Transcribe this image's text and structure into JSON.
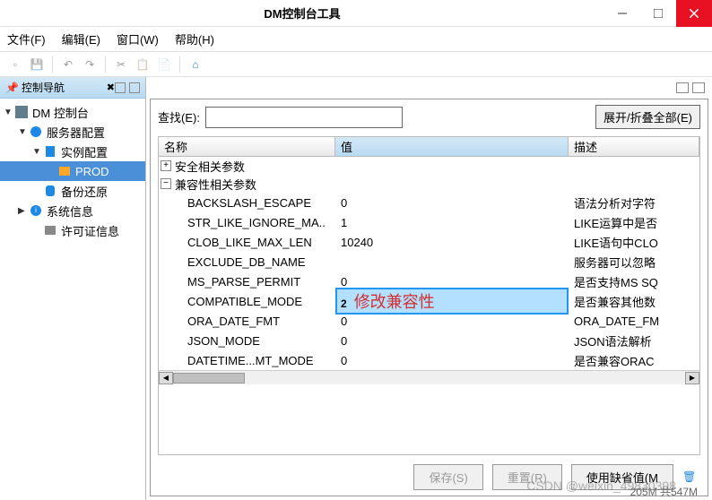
{
  "window": {
    "title": "DM控制台工具"
  },
  "menu": {
    "file": "文件(F)",
    "edit": "编辑(E)",
    "window": "窗口(W)",
    "help": "帮助(H)"
  },
  "nav": {
    "title": "控制导航",
    "close_mark": "✖",
    "items": {
      "root": "DM 控制台",
      "server_config": "服务器配置",
      "instance_config": "实例配置",
      "prod": "PROD",
      "backup_restore": "备份还原",
      "system_info": "系统信息",
      "license_info": "许可证信息"
    }
  },
  "content": {
    "search_label": "查找(E):",
    "search_value": "",
    "expand_collapse": "展开/折叠全部(E)",
    "columns": {
      "name": "名称",
      "value": "值",
      "desc": "描述"
    },
    "groups": {
      "security": "安全相关参数",
      "compat": "兼容性相关参数"
    },
    "rows": [
      {
        "name": "BACKSLASH_ESCAPE",
        "value": "0",
        "desc": "语法分析对字符"
      },
      {
        "name": "STR_LIKE_IGNORE_MA..",
        "value": "1",
        "desc": "LIKE运算中是否"
      },
      {
        "name": "CLOB_LIKE_MAX_LEN",
        "value": "10240",
        "desc": "LIKE语句中CLO"
      },
      {
        "name": "EXCLUDE_DB_NAME",
        "value": "",
        "desc": "服务器可以忽略"
      },
      {
        "name": "MS_PARSE_PERMIT",
        "value": "0",
        "desc": "是否支持MS SQ"
      },
      {
        "name": "COMPATIBLE_MODE",
        "value": "2",
        "desc": "是否兼容其他数"
      },
      {
        "name": "ORA_DATE_FMT",
        "value": "0",
        "desc": "ORA_DATE_FM"
      },
      {
        "name": "JSON_MODE",
        "value": "0",
        "desc": "JSON语法解析"
      },
      {
        "name": "DATETIME...MT_MODE",
        "value": "0",
        "desc": "是否兼容ORAC"
      }
    ],
    "annotation": "修改兼容性",
    "footer": {
      "save": "保存(S)",
      "reset": "重置(R)",
      "use_default": "使用缺省值(M"
    }
  },
  "status": "205M 共547M",
  "watermark": "CSDN @weixin_49830398"
}
